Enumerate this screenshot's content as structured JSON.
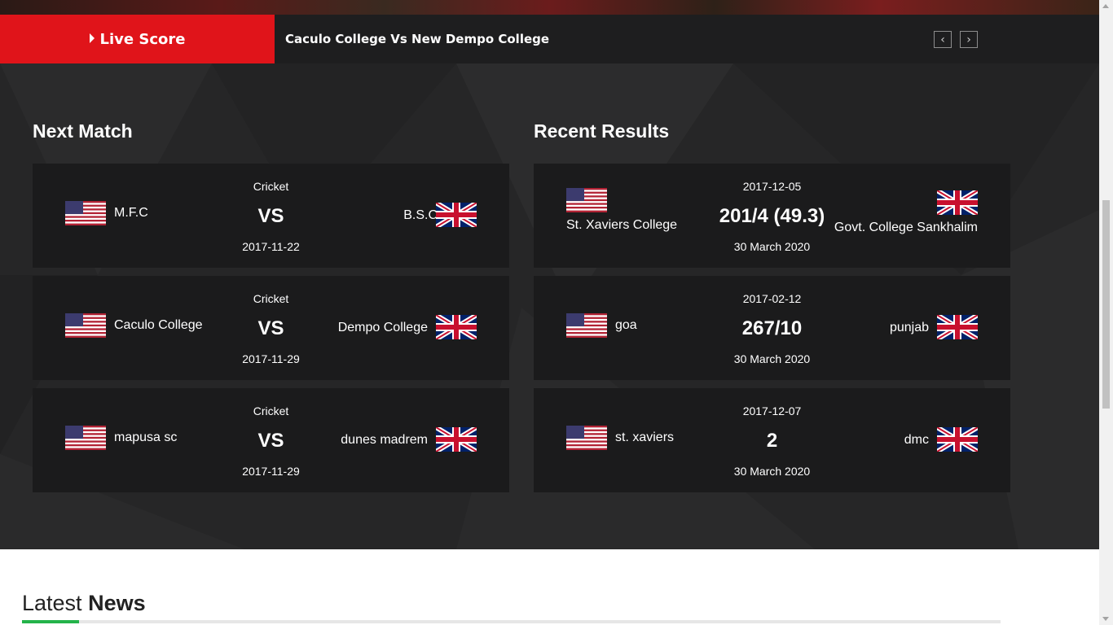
{
  "live_score": {
    "label": "Live Score",
    "ticker": "Caculo College Vs New Dempo College",
    "prev_label": "‹",
    "next_label": "›"
  },
  "next_match": {
    "title": "Next Match",
    "matches": [
      {
        "sport": "Cricket",
        "team_a": "M.F.C",
        "team_b": "B.S.C",
        "vs": "VS",
        "date": "2017-11-22",
        "flag_a": "us-flag",
        "flag_b": "uk-flag"
      },
      {
        "sport": "Cricket",
        "team_a": "Caculo College",
        "team_b": "Dempo College",
        "vs": "VS",
        "date": "2017-11-29",
        "flag_a": "us-flag",
        "flag_b": "uk-flag"
      },
      {
        "sport": "Cricket",
        "team_a": "mapusa sc",
        "team_b": "dunes madrem",
        "vs": "VS",
        "date": "2017-11-29",
        "flag_a": "us-flag",
        "flag_b": "uk-flag"
      }
    ]
  },
  "recent_results": {
    "title": "Recent Results",
    "results": [
      {
        "date": "2017-12-05",
        "team_a": "St. Xaviers College",
        "team_b": "Govt. College Sankhalim",
        "score": "201/4 (49.3)",
        "played_on": "30 March 2020",
        "flag_a": "us-flag",
        "flag_b": "uk-flag"
      },
      {
        "date": "2017-02-12",
        "team_a": "goa",
        "team_b": "punjab",
        "score": "267/10",
        "played_on": "30 March 2020",
        "flag_a": "us-flag",
        "flag_b": "uk-flag"
      },
      {
        "date": "2017-12-07",
        "team_a": "st. xaviers",
        "team_b": "dmc",
        "score": "2",
        "played_on": "30 March 2020",
        "flag_a": "us-flag",
        "flag_b": "uk-flag"
      }
    ]
  },
  "latest_news": {
    "title_light": "Latest",
    "title_bold": "News"
  },
  "colors": {
    "accent_red": "#e0141a",
    "accent_green": "#24b34a",
    "section_bg": "#262627",
    "card_bg": "#1b1b1c"
  }
}
